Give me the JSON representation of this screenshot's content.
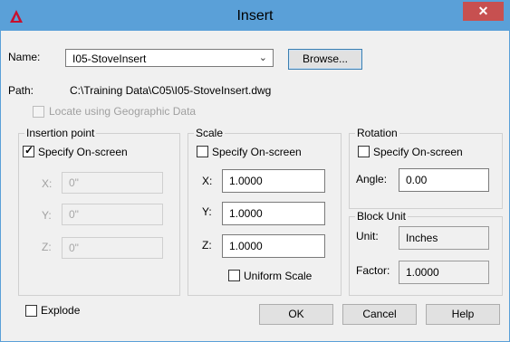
{
  "window": {
    "title": "Insert",
    "close_glyph": "✕",
    "app_icon": "autocad-logo-icon"
  },
  "name": {
    "label": "Name:",
    "value": "I05-StoveInsert",
    "browse_label": "Browse..."
  },
  "path": {
    "label": "Path:",
    "value": "C:\\Training Data\\C05\\I05-StoveInsert.dwg"
  },
  "geo": {
    "label": "Locate using Geographic Data",
    "checked": false
  },
  "insertion": {
    "title": "Insertion point",
    "specify_label": "Specify On-screen",
    "specify_checked": true,
    "x_label": "X:",
    "x_value": "0\"",
    "y_label": "Y:",
    "y_value": "0\"",
    "z_label": "Z:",
    "z_value": "0\""
  },
  "scale": {
    "title": "Scale",
    "specify_label": "Specify On-screen",
    "specify_checked": false,
    "x_label": "X:",
    "x_value": "1.0000",
    "y_label": "Y:",
    "y_value": "1.0000",
    "z_label": "Z:",
    "z_value": "1.0000",
    "uniform_label": "Uniform Scale",
    "uniform_checked": false
  },
  "rotation": {
    "title": "Rotation",
    "specify_label": "Specify On-screen",
    "specify_checked": false,
    "angle_label": "Angle:",
    "angle_value": "0.00"
  },
  "block_unit": {
    "title": "Block Unit",
    "unit_label": "Unit:",
    "unit_value": "Inches",
    "factor_label": "Factor:",
    "factor_value": "1.0000"
  },
  "explode": {
    "label": "Explode",
    "checked": false
  },
  "buttons": {
    "ok": "OK",
    "cancel": "Cancel",
    "help": "Help"
  },
  "colors": {
    "titlebar": "#5aa0d8",
    "close": "#c75050",
    "dialog_bg": "#f0f0f0"
  }
}
